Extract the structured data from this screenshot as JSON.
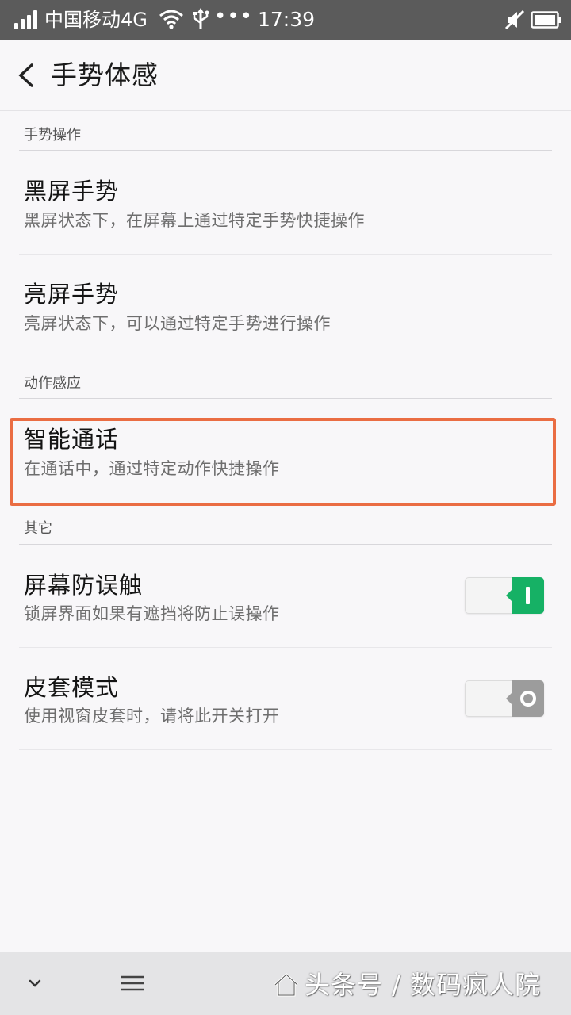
{
  "status_bar": {
    "carrier": "中国移动4G",
    "dots": "•••",
    "time": "17:39",
    "icons": [
      "signal-icon",
      "wifi-icon",
      "usb-icon",
      "mute-icon",
      "battery-icon"
    ]
  },
  "header": {
    "back_icon": "chevron-left-icon",
    "title": "手势体感"
  },
  "sections": [
    {
      "header": "手势操作",
      "items": [
        {
          "title": "黑屏手势",
          "subtitle": "黑屏状态下，在屏幕上通过特定手势快捷操作"
        },
        {
          "title": "亮屏手势",
          "subtitle": "亮屏状态下，可以通过特定手势进行操作"
        }
      ]
    },
    {
      "header": "动作感应",
      "items": [
        {
          "title": "智能通话",
          "subtitle": "在通话中，通过特定动作快捷操作",
          "highlighted": true
        }
      ]
    },
    {
      "header": "其它",
      "items": [
        {
          "title": "屏幕防误触",
          "subtitle": "锁屏界面如果有遮挡将防止误操作",
          "toggle": true
        },
        {
          "title": "皮套模式",
          "subtitle": "使用视窗皮套时，请将此开关打开",
          "toggle": false
        }
      ]
    }
  ],
  "colors": {
    "toggle_on": "#16b165",
    "toggle_off": "#9c9c9c",
    "highlight": "#ea6d43",
    "status_bar": "#5b5b5b"
  },
  "bottom_bar": {
    "icons": [
      "chevron-down-icon",
      "menu-icon",
      "home-icon"
    ],
    "watermark": "头条号 / 数码疯人院"
  }
}
